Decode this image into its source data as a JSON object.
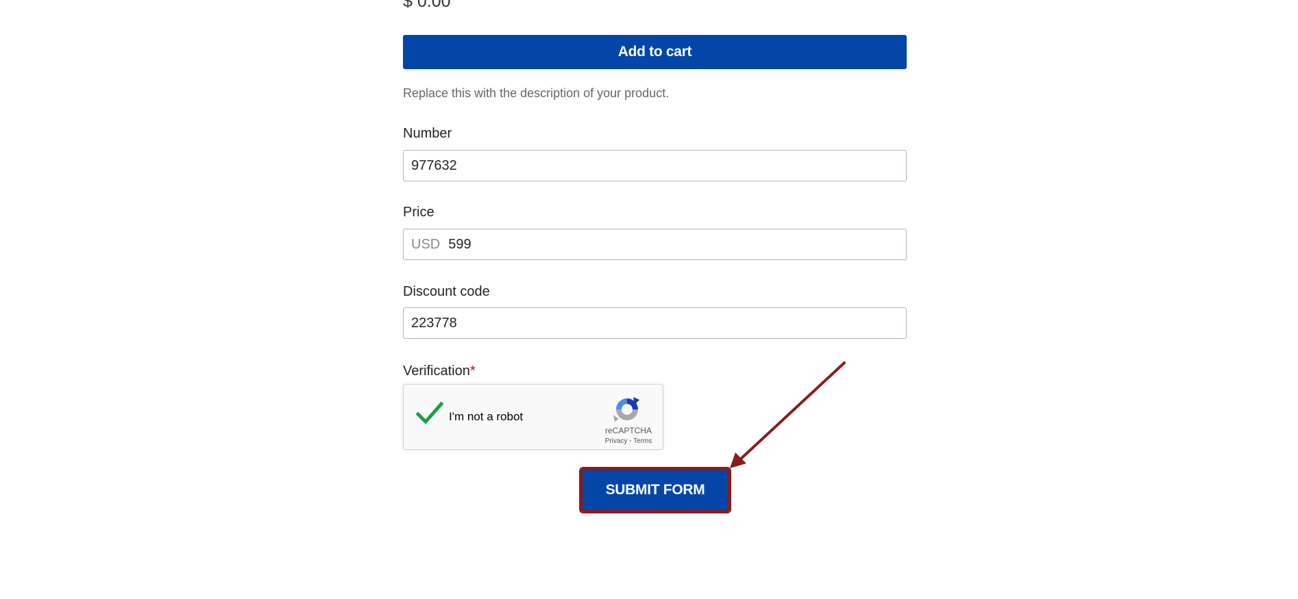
{
  "product": {
    "price_display": "$ 0.00",
    "add_to_cart_label": "Add to cart",
    "description": "Replace this with the description of your product."
  },
  "form": {
    "number": {
      "label": "Number",
      "value": "977632"
    },
    "price": {
      "label": "Price",
      "prefix": "USD",
      "value": "599"
    },
    "discount": {
      "label": "Discount code",
      "value": "223778"
    },
    "verification": {
      "label": "Verification",
      "required_mark": "*",
      "captcha_text": "I'm not a robot",
      "captcha_brand": "reCAPTCHA",
      "privacy_label": "Privacy",
      "separator": " - ",
      "terms_label": "Terms",
      "checked": true
    },
    "submit_label": "SUBMIT FORM"
  },
  "colors": {
    "primary": "#0346a8",
    "annotation": "#8a1c1c",
    "check": "#1e9b4a"
  },
  "icons": [
    "recaptcha-logo-icon",
    "checkmark-icon",
    "annotation-arrow-icon"
  ]
}
